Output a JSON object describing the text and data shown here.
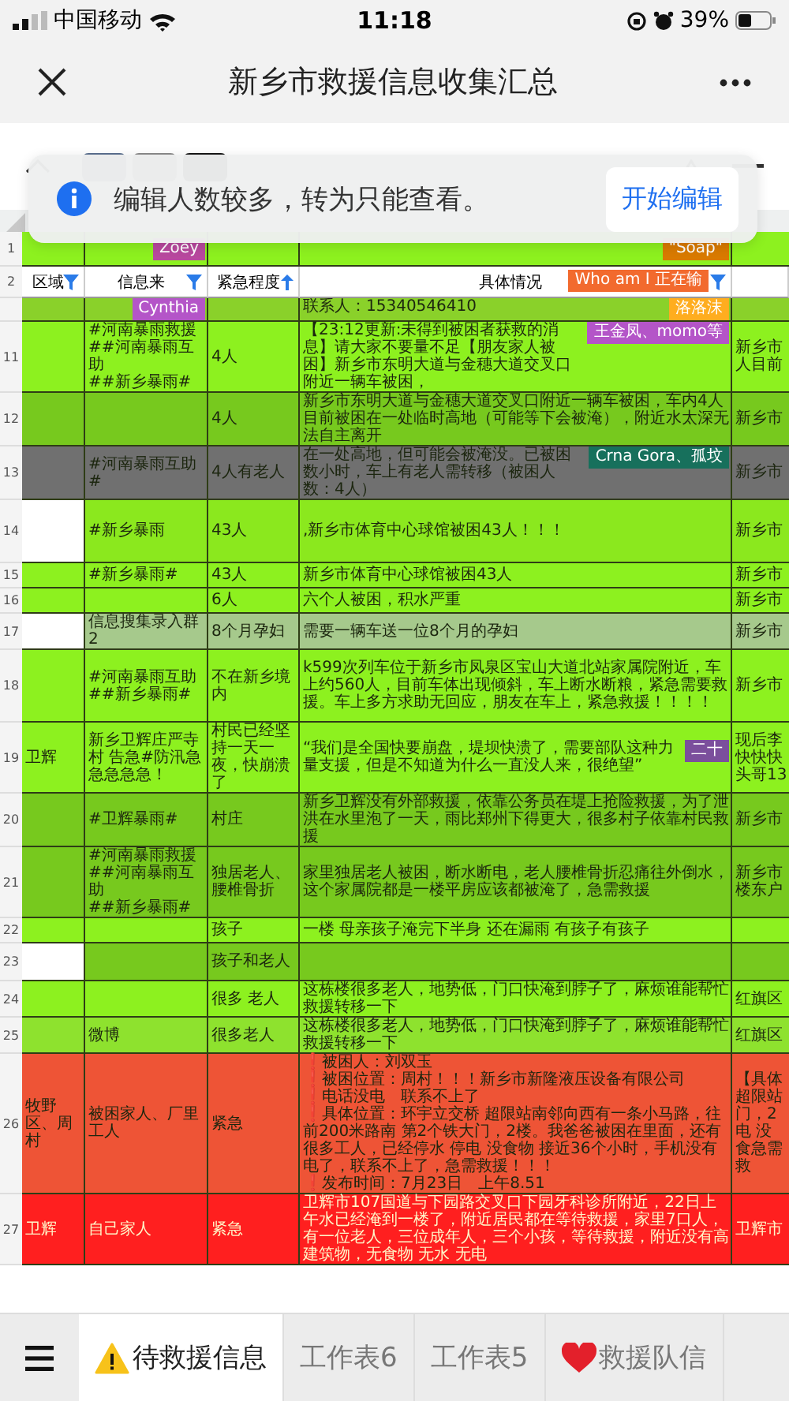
{
  "status_bar": {
    "carrier": "中国移动",
    "time": "11:18",
    "battery": "39%"
  },
  "nav": {
    "title": "新乡市救援信息收集汇总"
  },
  "banner": {
    "message": "编辑人数较多，转为只能查看。",
    "button": "开始编辑"
  },
  "sheet": {
    "rows": [
      {
        "kind": "data",
        "number": "1",
        "color": "#8df11f",
        "cells": [
          {},
          {
            "badge": {
              "text": "Zoey",
              "color": "#b8489e"
            }
          },
          {},
          {
            "badge": {
              "text": "\"Soap\"",
              "color": "#d97a00"
            }
          },
          {}
        ]
      },
      {
        "kind": "header",
        "number": "2",
        "cells": [
          {
            "label": "区域"
          },
          {
            "label": "信息来"
          },
          {
            "label": "紧急程度"
          },
          {
            "label": "具体情况",
            "badge": {
              "text": "Who am I 正在输",
              "color": "#f26a2e"
            }
          },
          {}
        ]
      },
      {
        "kind": "data",
        "color": "#8ad12a",
        "cells": [
          {},
          {
            "badge": {
              "text": "Cynthia",
              "color": "#b455c8"
            }
          },
          {},
          {
            "text": "联系人：15340546410",
            "badge": {
              "text": "洛洛沫",
              "color": "#ffad1f"
            }
          },
          {}
        ]
      },
      {
        "kind": "data",
        "number": "11",
        "color": "#8df11f",
        "cells": [
          {},
          {
            "text": "#河南暴雨救援\n##河南暴雨互助\n##新乡暴雨#"
          },
          {
            "text": "4人"
          },
          {
            "text": "【23:12更新:未得到被困者获救的消息】请大家不要量不足【朋友家人被困】新乡市东明大道与金穗大道交叉口附近一辆车被困，",
            "badge": {
              "text": "王金凤、momo等",
              "color": "#b455c8"
            }
          },
          {
            "text": "新乡市人目前"
          }
        ]
      },
      {
        "kind": "data",
        "number": "12",
        "color": "#77c91e",
        "cells": [
          {},
          {},
          {
            "text": "4人"
          },
          {
            "text": "新乡市东明大道与金穗大道交叉口附近一辆车被困，车内4人目前被困在一处临时高地（可能等下会被淹），附近水太深无法自主离开"
          },
          {
            "text": "新乡市"
          }
        ]
      },
      {
        "kind": "data",
        "number": "13",
        "color": "#707070",
        "cells": [
          {},
          {
            "text": "#河南暴雨互助#"
          },
          {
            "text": "4人有老人"
          },
          {
            "text": "在一处高地，但可能会被淹没。已被困数小时，车上有老人需转移（被困人数：4人）",
            "badge": {
              "text": "Crna Gora、孤坟",
              "color": "#17705c"
            }
          },
          {
            "text": "新乡市"
          }
        ]
      },
      {
        "kind": "data",
        "number": "14",
        "color": "#8be81e",
        "cells": [
          {
            "color": "#ffffff"
          },
          {
            "text": "#新乡暴雨"
          },
          {
            "text": "43人"
          },
          {
            "text": ",新乡市体育中心球馆被困43人！！！"
          },
          {
            "text": "新乡市"
          }
        ]
      },
      {
        "kind": "data",
        "number": "15",
        "color": "#8df11f",
        "cells": [
          {},
          {
            "text": "#新乡暴雨#"
          },
          {
            "text": "43人"
          },
          {
            "text": "新乡市体育中心球馆被困43人"
          },
          {
            "text": "新乡市"
          }
        ]
      },
      {
        "kind": "data",
        "number": "16",
        "color": "#8df11f",
        "cells": [
          {},
          {},
          {
            "text": "6人"
          },
          {
            "text": "六个人被困，积水严重"
          },
          {
            "text": "新乡市"
          }
        ]
      },
      {
        "kind": "data",
        "number": "17",
        "color": "#a6c98c",
        "cells": [
          {
            "color": "#ffffff"
          },
          {
            "text": "信息搜集录入群2"
          },
          {
            "text": "8个月孕妇"
          },
          {
            "text": "需要一辆车送一位8个月的孕妇"
          },
          {
            "text": "新乡市"
          }
        ]
      },
      {
        "kind": "data",
        "number": "18",
        "color": "#8df11f",
        "cells": [
          {},
          {
            "text": "#河南暴雨互助\n##新乡暴雨#"
          },
          {
            "text": "不在新乡境内"
          },
          {
            "text": "k599次列车位于新乡市凤泉区宝山大道北站家属院附近，车上约560人，目前车体出现倾斜，车上断水断粮，紧急需要救援。车上多方求助无回应，朋友在车上，紧急救援！！！！"
          },
          {
            "text": "新乡市"
          }
        ]
      },
      {
        "kind": "data",
        "number": "19",
        "color": "#8df11f",
        "cells": [
          {
            "text": "卫辉"
          },
          {
            "text": "新乡卫辉庄严寺村 告急#防汛急急急急急！"
          },
          {
            "text": "村民已经坚持一天一夜，快崩溃了"
          },
          {
            "text": "“我们是全国快要崩盘，堤坝快溃了，需要部队这种力量支援，但是不知道为什么一直没人来，很绝望”",
            "badge": {
              "text": "二十",
              "color": "#7b4f9c"
            }
          },
          {
            "text": "现后李快快快头哥13"
          }
        ]
      },
      {
        "kind": "data",
        "number": "20",
        "color": "#77c91e",
        "cells": [
          {},
          {
            "text": "#卫辉暴雨#"
          },
          {
            "text": "村庄"
          },
          {
            "text": "新乡卫辉没有外部救援，依靠公务员在堤上抢险救援，为了泄洪在水里泡了一天，雨比郑州下得更大，很多村子依靠村民救援"
          },
          {
            "text": "新乡市"
          }
        ]
      },
      {
        "kind": "data",
        "number": "21",
        "color": "#77c91e",
        "cells": [
          {},
          {
            "text": "#河南暴雨救援\n##河南暴雨互助\n##新乡暴雨#"
          },
          {
            "text": "独居老人、腰椎骨折"
          },
          {
            "text": "家里独居老人被困，断水断电，老人腰椎骨折忍痛往外倒水，这个家属院都是一楼平房应该都被淹了，急需救援"
          },
          {
            "text": "新乡市楼东户"
          }
        ]
      },
      {
        "kind": "data",
        "number": "22",
        "color": "#8df11f",
        "cells": [
          {},
          {},
          {
            "text": "孩子"
          },
          {
            "text": "一楼 母亲孩子淹完下半身 还在漏雨 有孩子有孩子"
          },
          {}
        ]
      },
      {
        "kind": "data",
        "number": "23",
        "color": "#77c91e",
        "cells": [
          {
            "color": "#ffffff"
          },
          {},
          {
            "text": "孩子和老人"
          },
          {},
          {}
        ]
      },
      {
        "kind": "data",
        "number": "24",
        "color": "#8df11f",
        "cells": [
          {},
          {},
          {
            "text": "很多 老人"
          },
          {
            "text": "这栋楼很多老人，地势低，门口快淹到脖子了，麻烦谁能帮忙救援转移一下"
          },
          {
            "text": "红旗区"
          }
        ]
      },
      {
        "kind": "data",
        "number": "25",
        "color": "#8ee22e",
        "cells": [
          {},
          {
            "text": "微博"
          },
          {
            "text": "很多老人"
          },
          {
            "text": "这栋楼很多老人，地势低，门口快淹到脖子了，麻烦谁能帮忙救援转移一下"
          },
          {
            "text": "红旗区"
          }
        ]
      },
      {
        "kind": "data",
        "number": "26",
        "color": "#ee5436",
        "cells": [
          {
            "text": "牧野区、周村"
          },
          {
            "text": "被困家人、厂里工人"
          },
          {
            "text": "紧急"
          },
          {
            "text": "❗被困人：刘双玉\n❗被困位置：周村！！！新乡市新隆液压设备有限公司\n❗电话没电　联系不上了\n❗具体位置：环宇立交桥 超限站南邻向西有一条小马路，往前200米路南 第2个铁大门，2楼。我爸爸被困在里面，还有很多工人，已经停水 停电 没食物 接近36个小时，手机没有电了，联系不上了，急需救援！！！\n❗发布时间：7月23日　上午8.51"
          },
          {
            "text": "【具体超限站门，2电 没食急需救"
          }
        ]
      },
      {
        "kind": "data",
        "number": "27",
        "color": "#ff1f1f",
        "cells": [
          {
            "text": "卫辉"
          },
          {
            "text": "自己家人"
          },
          {
            "text": "紧急"
          },
          {
            "text": "卫辉市107国道与下园路交叉口下园牙科诊所附近，22日上午水已经淹到一楼了，附近居民都在等待救援，家里7口人，有一位老人，三位成年人，三个小孩，等待救援，附近没有高建筑物，无食物 无水 无电"
          },
          {
            "text": "卫辉市"
          }
        ]
      }
    ]
  },
  "sheet_tabs": [
    {
      "label": "待救援信息",
      "selected": true
    },
    {
      "label": "工作表6",
      "selected": false
    },
    {
      "label": "工作表5",
      "selected": false
    },
    {
      "label": "救援队信",
      "selected": false
    }
  ]
}
